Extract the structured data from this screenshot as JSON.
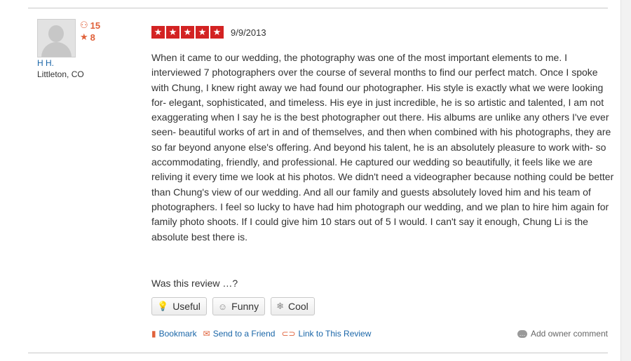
{
  "user": {
    "name": "H H.",
    "location": "Littleton, CO",
    "friends_count": "15",
    "reviews_count": "8"
  },
  "review": {
    "rating": 5,
    "star_glyph": "★",
    "date": "9/9/2013",
    "text": "When it came to our wedding, the photography was one of the most important elements to me. I interviewed 7 photographers over the course of several months to find our perfect match. Once I spoke with Chung, I knew right away we had found our photographer. His style is exactly what we were looking for- elegant, sophisticated, and timeless. His eye in just incredible, he is so artistic and talented, I am not exaggerating when I say he is the best photographer out there. His albums are unlike any others I've ever seen- beautiful works of art in and of themselves, and then when combined with his photographs, they are so far beyond anyone else's offering. And beyond his talent, he is an absolutely pleasure to work with- so accommodating, friendly, and professional. He captured our wedding so beautifully, it feels like we are reliving it every time we look at his photos. We didn't need a videographer because nothing could be better than Chung's view of our wedding. And all our family and guests absolutely loved him and his team of photographers. I feel so lucky to have had him photograph our wedding, and we plan to hire him again for family photo shoots. If I could give him 10 stars out of 5 I would. I can't say it enough, Chung Li is the absolute best there is."
  },
  "feedback": {
    "question": "Was this review …?",
    "useful_label": "Useful",
    "funny_label": "Funny",
    "cool_label": "Cool"
  },
  "actions": {
    "bookmark_label": "Bookmark",
    "send_label": "Send to a Friend",
    "link_label": "Link to This Review",
    "owner_comment_label": "Add owner comment"
  },
  "icons": {
    "friends": "friends-icon",
    "reviews": "star-icon",
    "useful": "lightbulb-icon",
    "funny": "smiley-icon",
    "cool": "snowflake-icon",
    "bookmark": "bookmark-icon",
    "send": "envelope-icon",
    "link": "link-icon",
    "owner_comment": "speech-bubble-icon"
  },
  "colors": {
    "star_red": "#d32323",
    "link_blue": "#1a66a8",
    "accent_orange": "#e0613a"
  }
}
